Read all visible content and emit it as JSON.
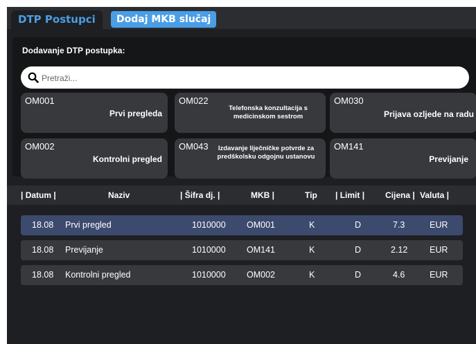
{
  "tabs": {
    "active": "DTP Postupci",
    "alt": "Dodaj MKB slučaj"
  },
  "panel": {
    "title": "Dodavanje DTP postupka:",
    "search_placeholder": "Pretraži...",
    "cards": [
      {
        "code": "OM001",
        "label": "Prvi pregleda"
      },
      {
        "code": "OM022",
        "label": "Telefonska konzultacija s medicinskom sestrom"
      },
      {
        "code": "OM030",
        "label": "Prijava ozljede na radu"
      },
      {
        "code": "OM002",
        "label": "Kontrolni pregled"
      },
      {
        "code": "OM043",
        "label": "Izdavanje liječničke potvrde za predškolsku odgojnu ustanovu"
      },
      {
        "code": "OM141",
        "label": "Previjanje"
      }
    ]
  },
  "table": {
    "headers": {
      "datum": "| Datum |",
      "naziv": "Naziv",
      "sifra": "| Šifra dj. |",
      "mkb": "MKB |",
      "tip": "Tip",
      "limit": "| Limit |",
      "cijena": "Cijena |",
      "valuta": "Valuta |"
    },
    "rows": [
      {
        "datum": "18.08",
        "naziv": "Prvi pregled",
        "sifra": "1010000",
        "mkb": "OM001",
        "tip": "K",
        "limit": "D",
        "cijena": "7.3",
        "valuta": "EUR"
      },
      {
        "datum": "18.08",
        "naziv": "Previjanje",
        "sifra": "1010000",
        "mkb": "OM141",
        "tip": "K",
        "limit": "D",
        "cijena": "2.12",
        "valuta": "EUR"
      },
      {
        "datum": "18.08",
        "naziv": "Kontrolni pregled",
        "sifra": "1010000",
        "mkb": "OM002",
        "tip": "K",
        "limit": "D",
        "cijena": "4.6",
        "valuta": "EUR"
      }
    ]
  }
}
